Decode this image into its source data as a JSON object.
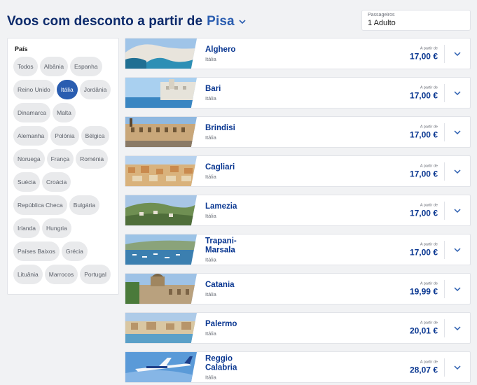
{
  "header": {
    "title_prefix": "Voos com desconto a partir de",
    "origin_city": "Pisa"
  },
  "passengers": {
    "label": "Passageiros",
    "value": "1 Adulto"
  },
  "filter": {
    "title": "País",
    "chips": [
      {
        "label": "Todos",
        "active": false
      },
      {
        "label": "Albânia",
        "active": false
      },
      {
        "label": "Espanha",
        "active": false
      },
      {
        "label": "Reino Unido",
        "active": false
      },
      {
        "label": "Itália",
        "active": true
      },
      {
        "label": "Jordânia",
        "active": false
      },
      {
        "label": "Dinamarca",
        "active": false
      },
      {
        "label": "Malta",
        "active": false
      },
      {
        "label": "Alemanha",
        "active": false
      },
      {
        "label": "Polónia",
        "active": false
      },
      {
        "label": "Bélgica",
        "active": false
      },
      {
        "label": "Noruega",
        "active": false
      },
      {
        "label": "França",
        "active": false
      },
      {
        "label": "Roménia",
        "active": false
      },
      {
        "label": "Suécia",
        "active": false
      },
      {
        "label": "Croácia",
        "active": false
      },
      {
        "label": "República Checa",
        "active": false
      },
      {
        "label": "Bulgária",
        "active": false
      },
      {
        "label": "Irlanda",
        "active": false
      },
      {
        "label": "Hungria",
        "active": false
      },
      {
        "label": "Países Baixos",
        "active": false
      },
      {
        "label": "Grécia",
        "active": false
      },
      {
        "label": "Lituânia",
        "active": false
      },
      {
        "label": "Marrocos",
        "active": false
      },
      {
        "label": "Portugal",
        "active": false
      }
    ]
  },
  "price_from_label": "A partir de",
  "flights": [
    {
      "name": "Alghero",
      "country": "Itália",
      "price": "17,00 €",
      "scene": "coast"
    },
    {
      "name": "Bari",
      "country": "Itália",
      "price": "17,00 €",
      "scene": "seafront"
    },
    {
      "name": "Brindisi",
      "country": "Itália",
      "price": "17,00 €",
      "scene": "palace"
    },
    {
      "name": "Cagliari",
      "country": "Itália",
      "price": "17,00 €",
      "scene": "town"
    },
    {
      "name": "Lamezia",
      "country": "Itália",
      "price": "17,00 €",
      "scene": "hills"
    },
    {
      "name": "Trapani-\nMarsala",
      "country": "Itália",
      "price": "17,00 €",
      "scene": "harbor"
    },
    {
      "name": "Catania",
      "country": "Itália",
      "price": "19,99 €",
      "scene": "cathedral"
    },
    {
      "name": "Palermo",
      "country": "Itália",
      "price": "20,01 €",
      "scene": "beach"
    },
    {
      "name": "Reggio\nCalabria",
      "country": "Itália",
      "price": "28,07 €",
      "scene": "plane"
    }
  ],
  "colors": {
    "brand_dark": "#073590",
    "brand_accent": "#2a5db0",
    "background": "#f1f2f4"
  },
  "icons": {
    "origin_dropdown": "chevron-down-icon",
    "card_expand": "chevron-down-icon"
  }
}
